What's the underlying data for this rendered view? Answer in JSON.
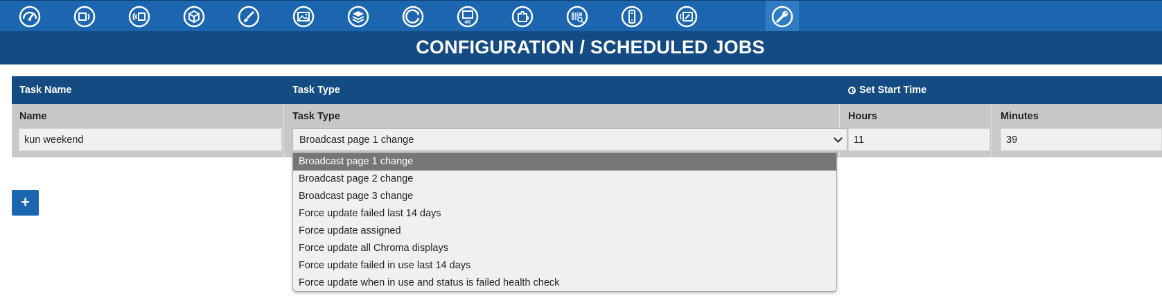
{
  "nav": {
    "icons": [
      "dashboard-icon",
      "remote-signal-icon",
      "broadcast-icon",
      "package-icon",
      "brush-icon",
      "gallery-icon",
      "layers-icon",
      "refresh-cycle-icon",
      "4k-display-icon",
      "puzzle-piece-icon",
      "barcode-scan-icon",
      "mobile-device-icon",
      "screen-settings-icon",
      "wrench-icon"
    ],
    "active_index": 13
  },
  "page": {
    "title": "CONFIGURATION / SCHEDULED JOBS"
  },
  "table": {
    "header": {
      "task_name": "Task Name",
      "task_type": "Task Type",
      "start_time": "Set Start Time"
    },
    "labels": {
      "name": "Name",
      "task_type": "Task Type",
      "hours": "Hours",
      "minutes": "Minutes"
    },
    "row": {
      "name": "kun weekend",
      "task_type": "Broadcast page 1 change",
      "hours": "11",
      "minutes": "39"
    }
  },
  "dropdown": {
    "selected_index": 0,
    "options": [
      "Broadcast page 1 change",
      "Broadcast page 2 change",
      "Broadcast page 3 change",
      "Force update failed last 14 days",
      "Force update assigned",
      "Force update all Chroma displays",
      "Force update failed in use last 14 days",
      "Force update when in use and status is failed health check"
    ]
  },
  "actions": {
    "add_label": "+"
  },
  "colors": {
    "nav_bg": "#1c66b0",
    "title_bg": "#134b82",
    "selected_option": "#767676"
  }
}
